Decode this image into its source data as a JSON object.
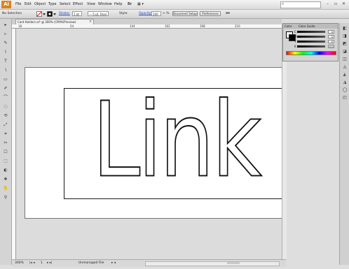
{
  "menubar": {
    "logo": "Ai",
    "items": [
      "File",
      "Edit",
      "Object",
      "Type",
      "Select",
      "Effect",
      "View",
      "Window",
      "Help"
    ],
    "bridge": "Br",
    "arrange": "▦ ▾",
    "window_controls": [
      "–",
      "▫",
      "✕"
    ]
  },
  "controlbar": {
    "selection": "No Selection",
    "stroke_label": "Stroke:",
    "stroke_value": "1 pt",
    "brush_label": "— 5 pt. Oval",
    "style_label": "Style:",
    "opacity_label": "Opacity:",
    "opacity_value": "100",
    "opacity_unit": "> %",
    "document_setup": "Document Setup",
    "preferences": "Preferences"
  },
  "document": {
    "tab_label": "Card Holders.ai* @ 300% (CMYK/Preview)",
    "tab_close": "×"
  },
  "ruler": {
    "h_ticks": [
      "18",
      "54",
      "144",
      "162",
      "198",
      "216"
    ]
  },
  "artwork": {
    "text": "Link"
  },
  "status": {
    "zoom": "300%",
    "page": "1",
    "status_mode": "Unmanaged File"
  },
  "color_panel": {
    "tabs": [
      "Color",
      "Color Guide"
    ],
    "channels": [
      {
        "label": "C",
        "value": "0"
      },
      {
        "label": "M",
        "value": "0"
      },
      {
        "label": "Y",
        "value": "0"
      },
      {
        "label": "K",
        "value": "100"
      }
    ],
    "value_unit": "%"
  },
  "tools": [
    "▸",
    "▹",
    "✎",
    "⌇",
    "T",
    "∖",
    "▭",
    "✐",
    "⌒",
    "◌",
    "⟲",
    "⤢",
    "⌗",
    "✂",
    "☐",
    "⬚",
    "◐",
    "❖",
    "✋",
    "⚲"
  ],
  "right_strip": [
    "◧",
    "◨",
    "◩",
    "◪",
    "◫",
    "◬",
    "◭",
    "◮",
    "◯",
    "◰"
  ]
}
